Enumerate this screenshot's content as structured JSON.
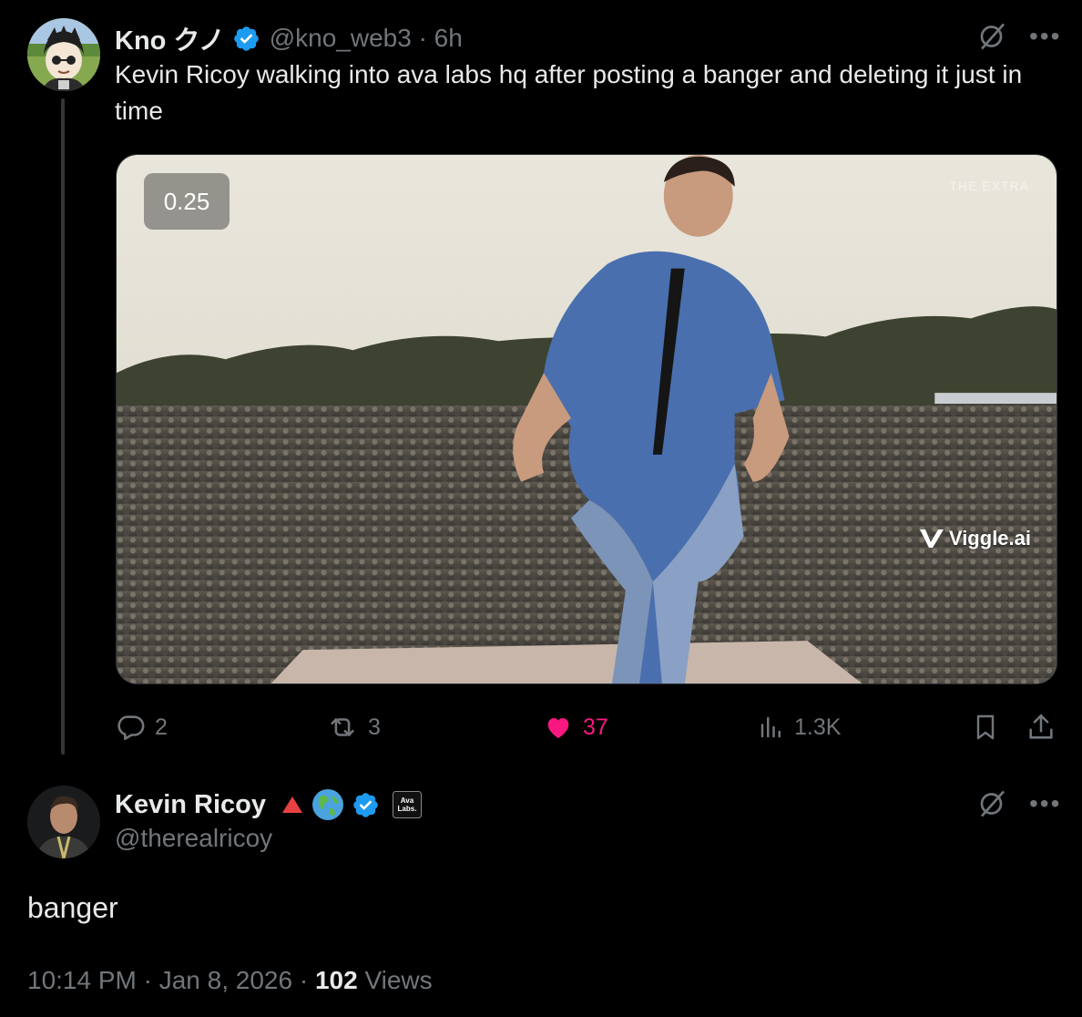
{
  "tweet": {
    "author_name": "Kno クノ",
    "handle": "@kno_web3",
    "separator": "·",
    "time_ago": "6h",
    "text": "Kevin Ricoy walking into ava labs hq after posting a banger and deleting it just in time",
    "media": {
      "speed_label": "0.25",
      "watermark": "Viggle.ai",
      "corner_mark": "THE EXTRA"
    },
    "actions": {
      "replies": "2",
      "reposts": "3",
      "likes": "37",
      "views": "1.3K"
    }
  },
  "reply": {
    "author_name": "Kevin Ricoy",
    "handle": "@therealricoy",
    "ava_badge": "Ava Labs.",
    "text": "banger",
    "timestamp": "10:14 PM · Jan 8, 2026 ·",
    "views_count": "102",
    "views_label": "Views"
  },
  "icons": {
    "verified": "verified-badge-icon",
    "grok": "grok-icon",
    "more": "more-icon",
    "reply": "reply-icon",
    "repost": "repost-icon",
    "like": "like-icon",
    "views": "views-icon",
    "bookmark": "bookmark-icon",
    "share": "share-icon",
    "red_triangle": "red-triangle-icon",
    "globe": "globe-icon"
  },
  "colors": {
    "background": "#000000",
    "text_primary": "#e7e9ea",
    "text_secondary": "#71767b",
    "verified_blue": "#1d9bf0",
    "like_pink": "#f91880"
  }
}
